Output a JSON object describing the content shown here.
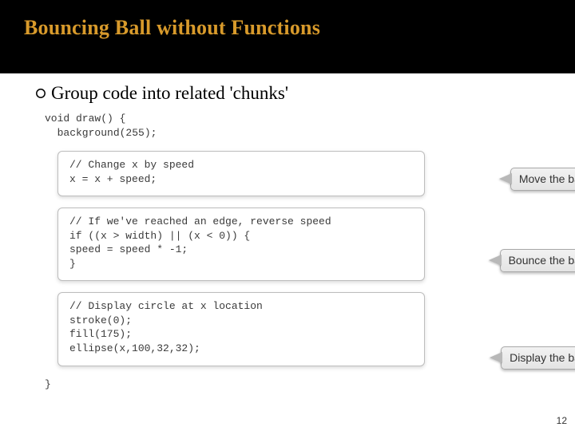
{
  "title": "Bouncing Ball without Functions",
  "bullet": "Group code into related 'chunks'",
  "code": {
    "draw_open": "void draw() {",
    "bg": "  background(255);",
    "close": "}",
    "chunks": [
      {
        "comment": "// Change x by speed",
        "lines": [
          "x = x + speed;"
        ],
        "callout": "Move the ball!"
      },
      {
        "comment": "// If we've reached an edge, reverse speed",
        "lines": [
          "if ((x > width) || (x < 0)) {",
          "speed = speed * -1;",
          "}"
        ],
        "callout": "Bounce the ball!"
      },
      {
        "comment": "// Display circle at x location",
        "lines": [
          "stroke(0);",
          "fill(175);",
          "ellipse(x,100,32,32);"
        ],
        "callout": "Display the ball!"
      }
    ]
  },
  "page_number": "12"
}
